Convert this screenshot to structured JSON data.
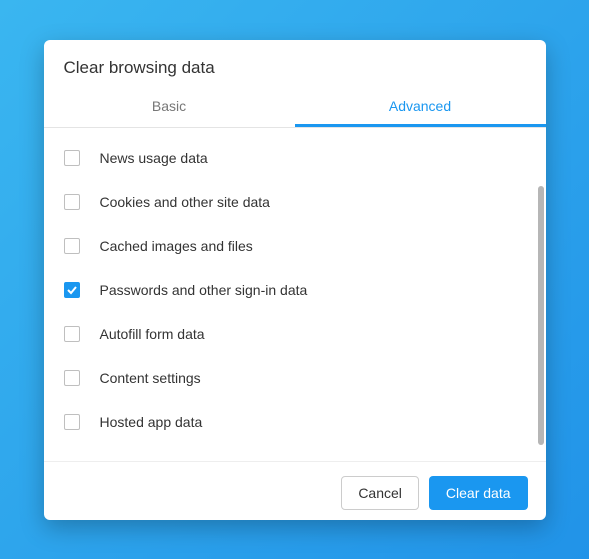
{
  "dialog": {
    "title": "Clear browsing data",
    "tabs": [
      {
        "label": "Basic",
        "active": false
      },
      {
        "label": "Advanced",
        "active": true
      }
    ],
    "items": [
      {
        "label": "News usage data",
        "checked": false
      },
      {
        "label": "Cookies and other site data",
        "checked": false
      },
      {
        "label": "Cached images and files",
        "checked": false
      },
      {
        "label": "Passwords and other sign-in data",
        "checked": true
      },
      {
        "label": "Autofill form data",
        "checked": false
      },
      {
        "label": "Content settings",
        "checked": false
      },
      {
        "label": "Hosted app data",
        "checked": false
      }
    ],
    "buttons": {
      "cancel": "Cancel",
      "confirm": "Clear data"
    }
  }
}
